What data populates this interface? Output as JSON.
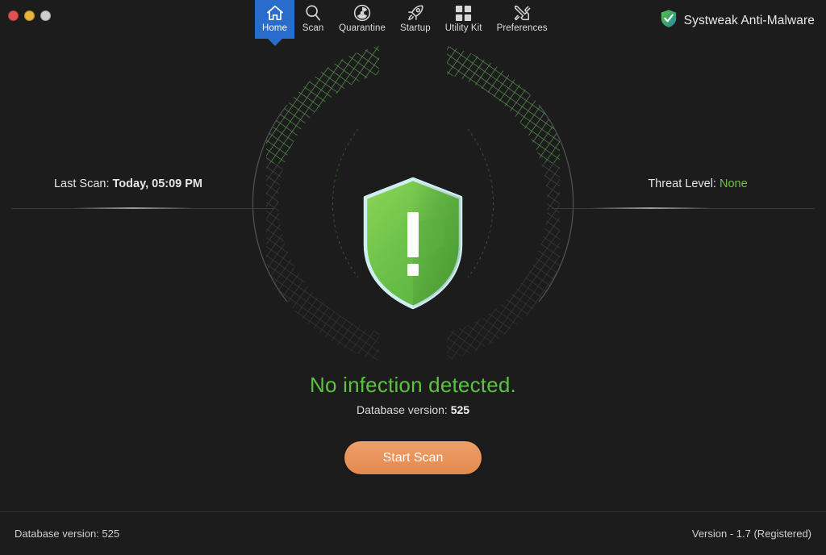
{
  "window": {
    "traffic_lights": [
      {
        "name": "close",
        "color": "#e05252"
      },
      {
        "name": "minimize",
        "color": "#e8b33a"
      },
      {
        "name": "zoom",
        "color": "#cfcfcf"
      }
    ]
  },
  "toolbar": {
    "active": "Home",
    "active_color": "#2a6ccb",
    "tabs": [
      {
        "label": "Home",
        "icon": "home-icon"
      },
      {
        "label": "Scan",
        "icon": "search-icon"
      },
      {
        "label": "Quarantine",
        "icon": "radiation-icon"
      },
      {
        "label": "Startup",
        "icon": "rocket-icon"
      },
      {
        "label": "Utility Kit",
        "icon": "grid-icon"
      },
      {
        "label": "Preferences",
        "icon": "tools-icon"
      }
    ]
  },
  "brand": {
    "name": "Systweak Anti-Malware",
    "icon": "shield-check-icon"
  },
  "hero": {
    "shield_icon": "shield-exclamation-icon",
    "shield_color": "#6cc24a",
    "last_scan_label": "Last Scan:",
    "last_scan_value": "Today, 05:09 PM",
    "threat_level_label": "Threat Level:",
    "threat_level_value": "None",
    "threat_level_color": "#6fc24a"
  },
  "status": {
    "headline": "No infection detected.",
    "headline_color": "#5cc23f",
    "db_label": "Database version:",
    "db_value": "525"
  },
  "actions": {
    "start_scan_label": "Start Scan",
    "start_scan_color": "#e8935a"
  },
  "footer": {
    "database_version": "Database version: 525",
    "version": "Version  -  1.7 (Registered)"
  }
}
